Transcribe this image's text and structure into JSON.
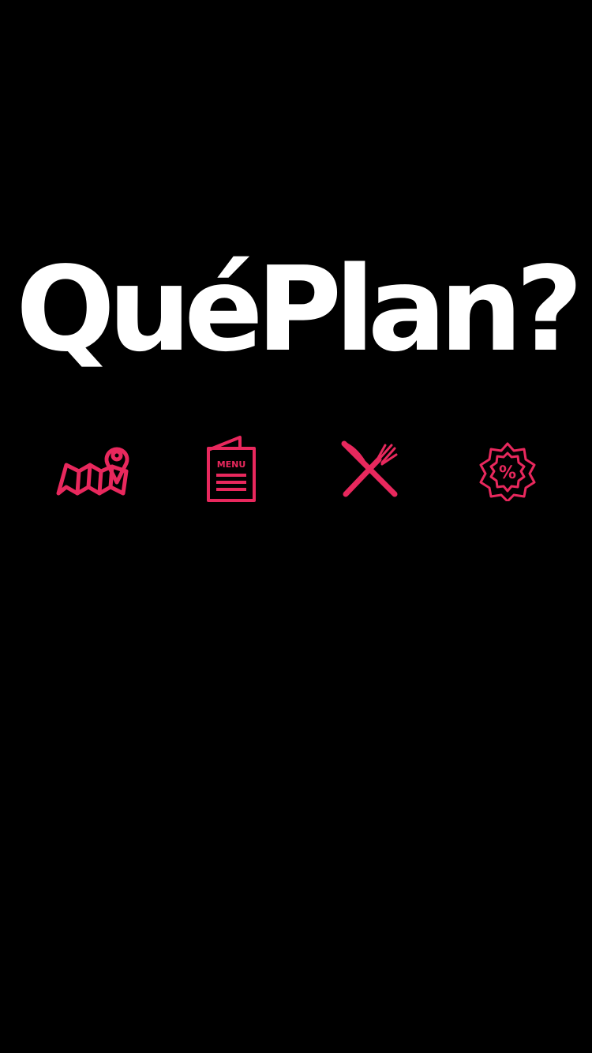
{
  "splash": {
    "logo_text": "QuéPlan?",
    "text_color": "#ffffff",
    "background_color": "#000000",
    "accent_color": "#e8285d",
    "icons": [
      {
        "name": "map-pin-icon"
      },
      {
        "name": "menu-card-icon",
        "label": "MENU"
      },
      {
        "name": "cutlery-icon"
      },
      {
        "name": "discount-badge-icon",
        "label": "%"
      }
    ]
  }
}
